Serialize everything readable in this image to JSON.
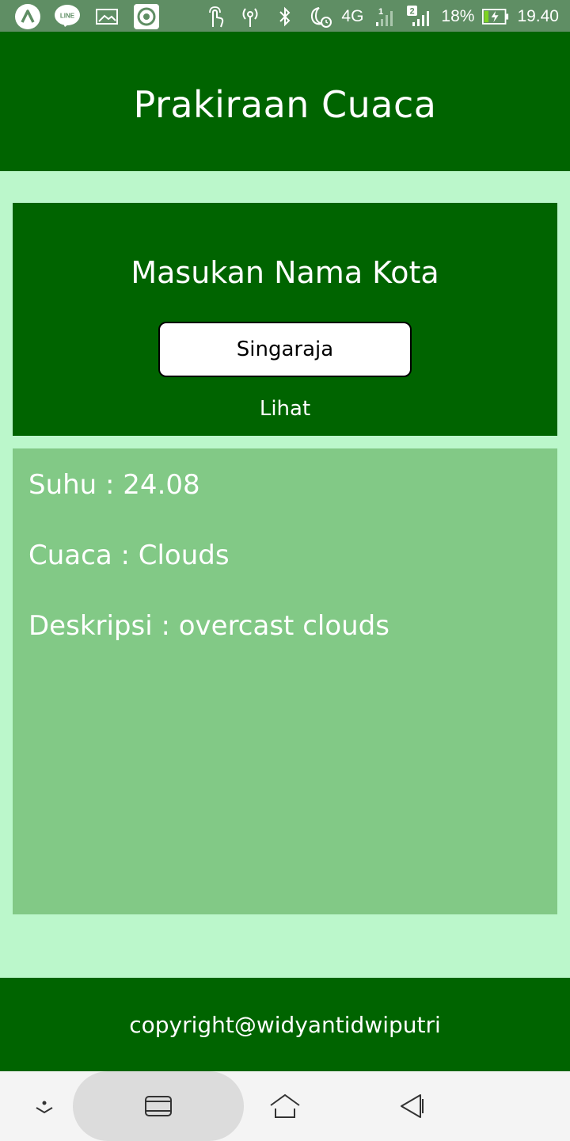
{
  "status_bar": {
    "battery_percent": "18%",
    "time": "19.40",
    "network": "4G",
    "sim1_badge": "1",
    "sim2_badge": "2",
    "line_badge": "LINE"
  },
  "header": {
    "title": "Prakiraan Cuaca"
  },
  "input_card": {
    "heading": "Masukan Nama Kota",
    "city_value": "Singaraja",
    "submit_label": "Lihat"
  },
  "result": {
    "temperature_text": "Suhu : 24.08",
    "weather_text": "Cuaca : Clouds",
    "description_text": "Deskripsi : overcast clouds"
  },
  "footer": {
    "copyright": "copyright@widyantidwiputri"
  },
  "colors": {
    "header_bg": "#006400",
    "page_bg": "#bbf7cb",
    "result_bg": "#82c986",
    "statusbar_bg": "#5f8e64"
  },
  "icons": {
    "status_left": [
      "app-launcher-icon",
      "line-app-icon",
      "gallery-icon",
      "record-icon"
    ],
    "status_right": [
      "touch-icon",
      "hotspot-icon",
      "bluetooth-icon",
      "night-mode-alarm-icon",
      "signal-sim1-icon",
      "signal-sim2-icon",
      "battery-charging-icon"
    ],
    "nav": [
      "hide-nav-icon",
      "recent-apps-icon",
      "home-icon",
      "back-icon"
    ]
  }
}
